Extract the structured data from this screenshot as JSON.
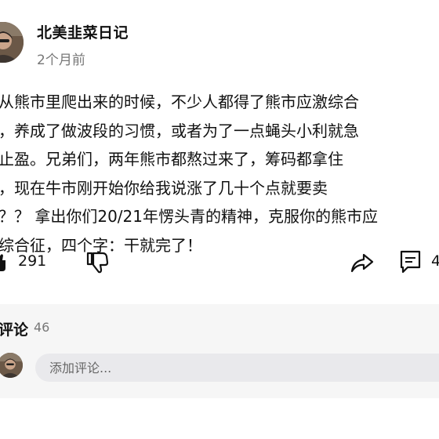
{
  "post": {
    "author": "北美韭菜日记",
    "time": "2个月前",
    "lines": [
      "从熊市里爬出来的时候，不少人都得了熊市应激综合",
      "，养成了做波段的习惯，或者为了一点蝇头小利就急",
      "止盈。兄弟们，两年熊市都熬过来了，筹码都拿住",
      "，现在牛市刚开始你给我说涨了几十个点就要卖",
      "？？ 拿出你们20/21年愣头青的精神，克服你的熊市应",
      "综合征，四个字：干就完了！"
    ]
  },
  "actions": {
    "like_count": "291",
    "comment_count_partial": "4"
  },
  "comments": {
    "title": "评论",
    "count": "46",
    "input_placeholder": "添加评论..."
  },
  "icons": [
    "like-icon",
    "dislike-icon",
    "share-icon",
    "comment-icon"
  ]
}
